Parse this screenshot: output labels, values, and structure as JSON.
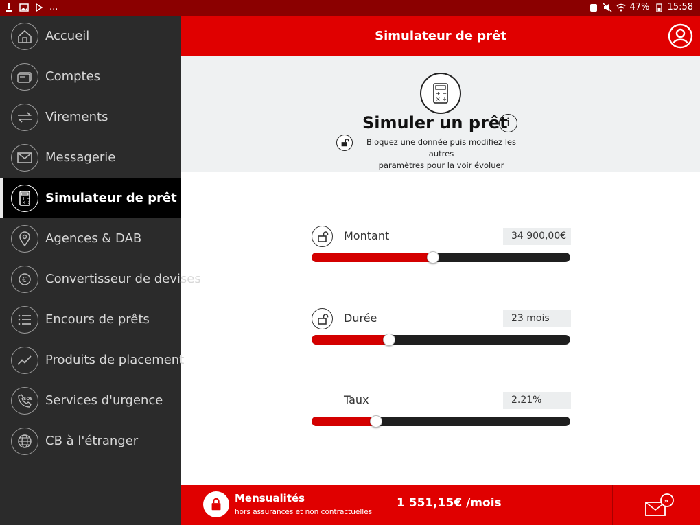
{
  "status_bar": {
    "battery": "47%",
    "time": "15:58",
    "ellipsis": "..."
  },
  "header": {
    "title": "Simulateur de prêt"
  },
  "sidebar": {
    "items": [
      {
        "label": "Accueil",
        "icon": "home-icon"
      },
      {
        "label": "Comptes",
        "icon": "card-icon"
      },
      {
        "label": "Virements",
        "icon": "transfer-arrows-icon"
      },
      {
        "label": "Messagerie",
        "icon": "envelope-icon"
      },
      {
        "label": "Simulateur de prêt",
        "icon": "calculator-icon",
        "active": true
      },
      {
        "label": "Agences & DAB",
        "icon": "location-pin-icon"
      },
      {
        "label": "Convertisseur de devises",
        "icon": "euro-exchange-icon"
      },
      {
        "label": "Encours de prêts",
        "icon": "list-icon"
      },
      {
        "label": "Produits de placement",
        "icon": "chart-line-icon"
      },
      {
        "label": "Services d'urgence",
        "icon": "sos-phone-icon"
      },
      {
        "label": "CB à l'étranger",
        "icon": "globe-icon"
      }
    ]
  },
  "intro": {
    "heading": "Simuler un prêt",
    "info_symbol": "i",
    "desc_line1": "Bloquez une donnée puis modifiez les autres",
    "desc_line2": "paramètres pour la voir évoluer"
  },
  "sliders": [
    {
      "name": "Montant",
      "value": "34 900,00€",
      "position": 0.47,
      "lockable": true
    },
    {
      "name": "Durée",
      "value": "23 mois",
      "position": 0.3,
      "lockable": true
    },
    {
      "name": "Taux",
      "value": "2.21%",
      "position": 0.25,
      "lockable": false
    }
  ],
  "footer": {
    "label": "Mensualités",
    "sublabel": "hors assurances et non contractuelles",
    "amount": "1 551,15€ /mois"
  },
  "colors": {
    "brand_red": "#e00000",
    "sidebar_bg": "#2b2b2b",
    "active_bg": "#000000"
  }
}
